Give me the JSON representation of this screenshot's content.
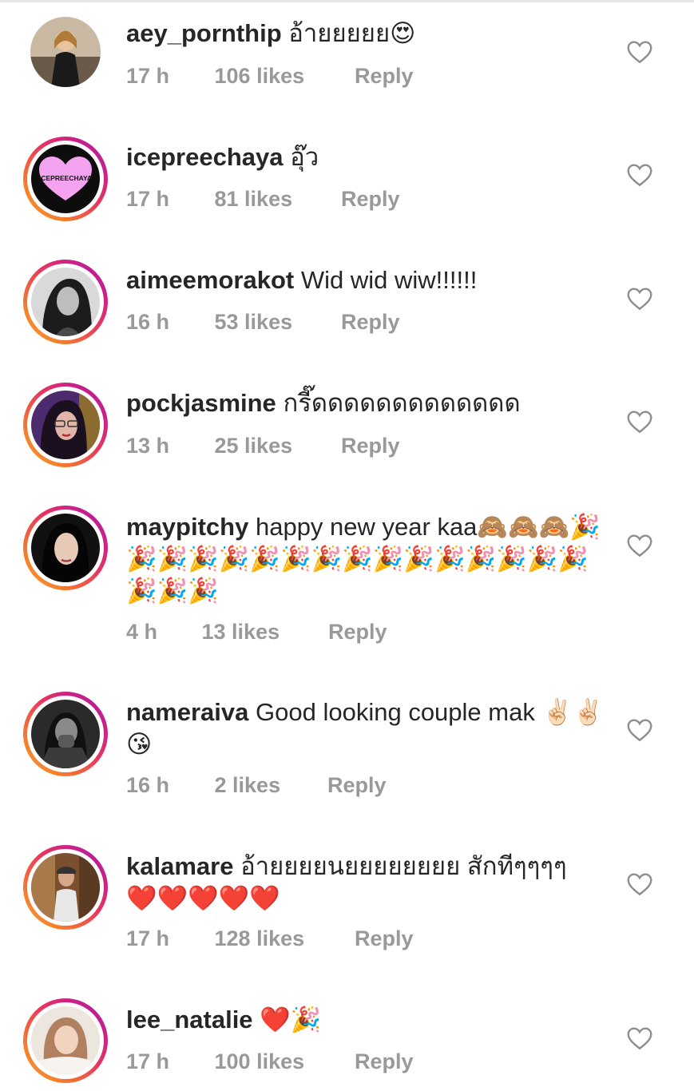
{
  "comments": [
    {
      "username": "aey_pornthip",
      "text": "อ้ายยยยย😍",
      "time": "17 h",
      "likes": "106 likes",
      "reply": "Reply"
    },
    {
      "username": "icepreechaya",
      "text": "อุ๊ว",
      "time": "17 h",
      "likes": "81 likes",
      "reply": "Reply",
      "avatar_label": "ICEPREECHAYA"
    },
    {
      "username": "aimeemorakot",
      "text": "Wid wid wiw!!!!!!",
      "time": "16 h",
      "likes": "53 likes",
      "reply": "Reply"
    },
    {
      "username": "pockjasmine",
      "text": "กรี๊ดดดดดดดดดดดดด",
      "time": "13 h",
      "likes": "25 likes",
      "reply": "Reply"
    },
    {
      "username": "maypitchy",
      "text": "happy new year kaa🙈🙈🙈🎉🎉🎉🎉🎉🎉🎉🎉🎉🎉🎉🎉🎉🎉🎉🎉🎉🎉🎉",
      "time": "4 h",
      "likes": "13 likes",
      "reply": "Reply"
    },
    {
      "username": "nameraiva",
      "text": "Good looking couple mak ✌🏻✌🏻😘",
      "time": "16 h",
      "likes": "2 likes",
      "reply": "Reply"
    },
    {
      "username": "kalamare",
      "text": "อ้ายยยยนยยยยยยยย สักทีๆๆๆๆ❤️❤️❤️❤️❤️",
      "time": "17 h",
      "likes": "128 likes",
      "reply": "Reply"
    },
    {
      "username": "lee_natalie",
      "text": "❤️🎉",
      "time": "17 h",
      "likes": "100 likes",
      "reply": "Reply"
    }
  ],
  "colors": {
    "username": "#262626",
    "meta": "#999999",
    "ring_start": "#f9a134",
    "ring_end": "#a11ea3",
    "heart_outline": "#8e8e8e"
  },
  "icons": {
    "like": "heart-outline-icon"
  }
}
